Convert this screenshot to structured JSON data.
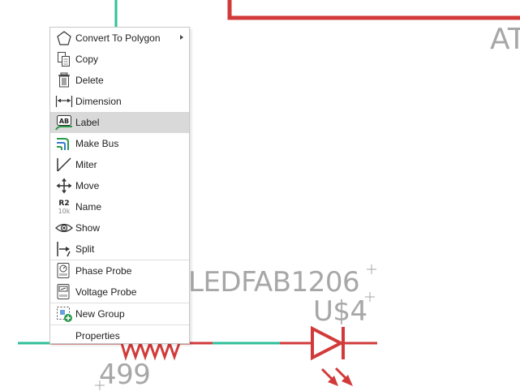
{
  "schematic": {
    "part_value": "LEDFAB1206",
    "part_name": "U$4",
    "resistor_value": "499",
    "frame_text": "AT",
    "colors": {
      "net": "#2fbf9a",
      "part": "#d23a3a",
      "text": "#a7a7a7",
      "background": "#ffffff"
    }
  },
  "context_menu": {
    "highlighted": "Label",
    "groups": [
      [
        {
          "label": "Convert To Polygon",
          "icon": "polygon-icon",
          "submenu": true
        },
        {
          "label": "Copy",
          "icon": "copy-icon"
        },
        {
          "label": "Delete",
          "icon": "trash-icon"
        },
        {
          "label": "Dimension",
          "icon": "dimension-icon"
        },
        {
          "label": "Label",
          "icon": "label-icon"
        },
        {
          "label": "Make Bus",
          "icon": "make-bus-icon"
        },
        {
          "label": "Miter",
          "icon": "miter-icon"
        },
        {
          "label": "Move",
          "icon": "move-icon"
        },
        {
          "label": "Name",
          "icon": "name-icon"
        },
        {
          "label": "Show",
          "icon": "eye-icon"
        },
        {
          "label": "Split",
          "icon": "split-icon"
        }
      ],
      [
        {
          "label": "Phase Probe",
          "icon": "phase-probe-icon"
        },
        {
          "label": "Voltage Probe",
          "icon": "voltage-probe-icon"
        }
      ],
      [
        {
          "label": "New Group",
          "icon": "new-group-icon"
        }
      ],
      [
        {
          "label": "Properties",
          "icon": ""
        }
      ]
    ],
    "name_icon_text": {
      "top": "R2",
      "bottom": "10k"
    },
    "label_icon_text": "AB"
  }
}
